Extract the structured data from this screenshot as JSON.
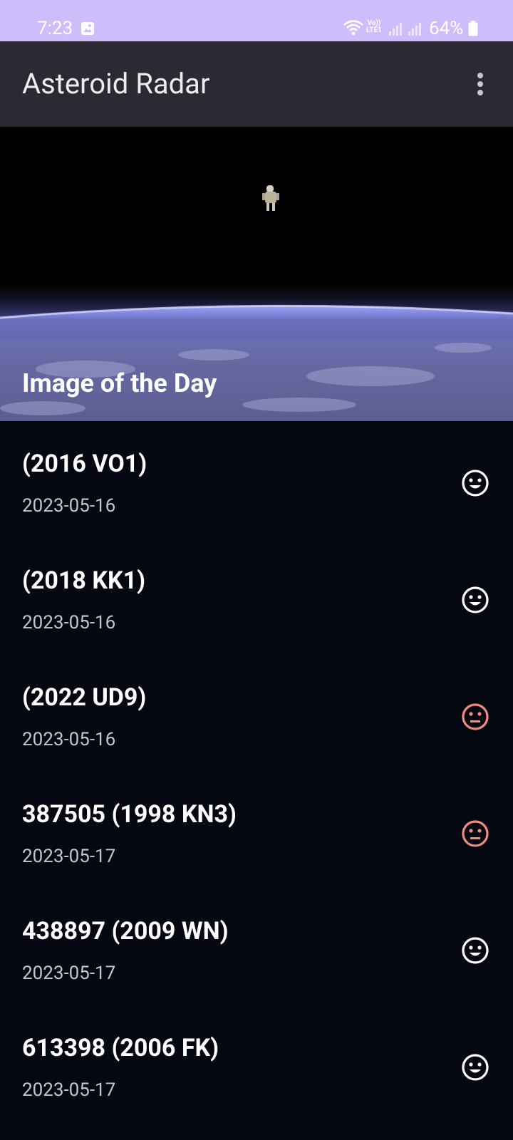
{
  "status_bar": {
    "time": "7:23",
    "volte_top": "Vo))",
    "volte_bottom": "LTE1",
    "battery": "64%"
  },
  "app_bar": {
    "title": "Asteroid Radar",
    "menu_icon": "more-vert-icon"
  },
  "image_of_day": {
    "caption": "Image of the Day"
  },
  "colors": {
    "status_bar": "#cdbdfb",
    "app_bar": "#2b2a33",
    "background": "#050711",
    "safe": "#ffffff",
    "hazardous": "#f28b82"
  },
  "asteroids": [
    {
      "name": "(2016 VO1)",
      "date": "2023-05-16",
      "status_icon": "happy-face-icon"
    },
    {
      "name": "(2018 KK1)",
      "date": "2023-05-16",
      "status_icon": "happy-face-icon"
    },
    {
      "name": "(2022 UD9)",
      "date": "2023-05-16",
      "status_icon": "neutral-face-icon"
    },
    {
      "name": "387505 (1998 KN3)",
      "date": "2023-05-17",
      "status_icon": "neutral-face-icon"
    },
    {
      "name": "438897 (2009 WN)",
      "date": "2023-05-17",
      "status_icon": "happy-face-icon"
    },
    {
      "name": "613398 (2006 FK)",
      "date": "2023-05-17",
      "status_icon": "happy-face-icon"
    }
  ]
}
